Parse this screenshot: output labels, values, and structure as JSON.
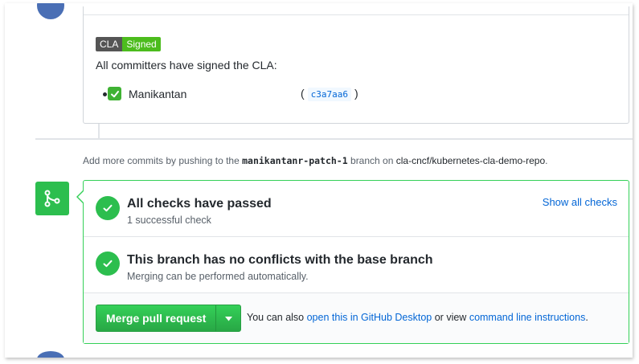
{
  "cla": {
    "badge_left": "CLA",
    "badge_right": "Signed",
    "message": "All committers have signed the CLA:",
    "committers": [
      {
        "name": "Manikantan",
        "sha": "c3a7aa6",
        "open_paren": "(",
        "close_paren": ")"
      }
    ]
  },
  "push_hint": {
    "prefix": "Add more commits by pushing to the",
    "branch": "manikantanr-patch-1",
    "middle": "branch on",
    "repo": "cla-cncf/kubernetes-cla-demo-repo",
    "suffix": "."
  },
  "merge_box": {
    "checks": {
      "title": "All checks have passed",
      "subtitle": "1 successful check",
      "show_all_label": "Show all checks"
    },
    "conflicts": {
      "title": "This branch has no conflicts with the base branch",
      "subtitle": "Merging can be performed automatically."
    },
    "merge": {
      "button_label": "Merge pull request",
      "alt_prefix": "You can also",
      "desktop_link": "open this in GitHub Desktop",
      "alt_middle": "or view",
      "cli_link": "command line instructions",
      "alt_suffix": "."
    }
  },
  "icons": {
    "merge": "git-merge-icon",
    "check": "check-icon",
    "caret": "caret-down-icon",
    "emoji": "white-check-mark-emoji"
  },
  "colors": {
    "success": "#2cbe4e",
    "link": "#0366d6",
    "badge_green": "#4cbc1d"
  }
}
